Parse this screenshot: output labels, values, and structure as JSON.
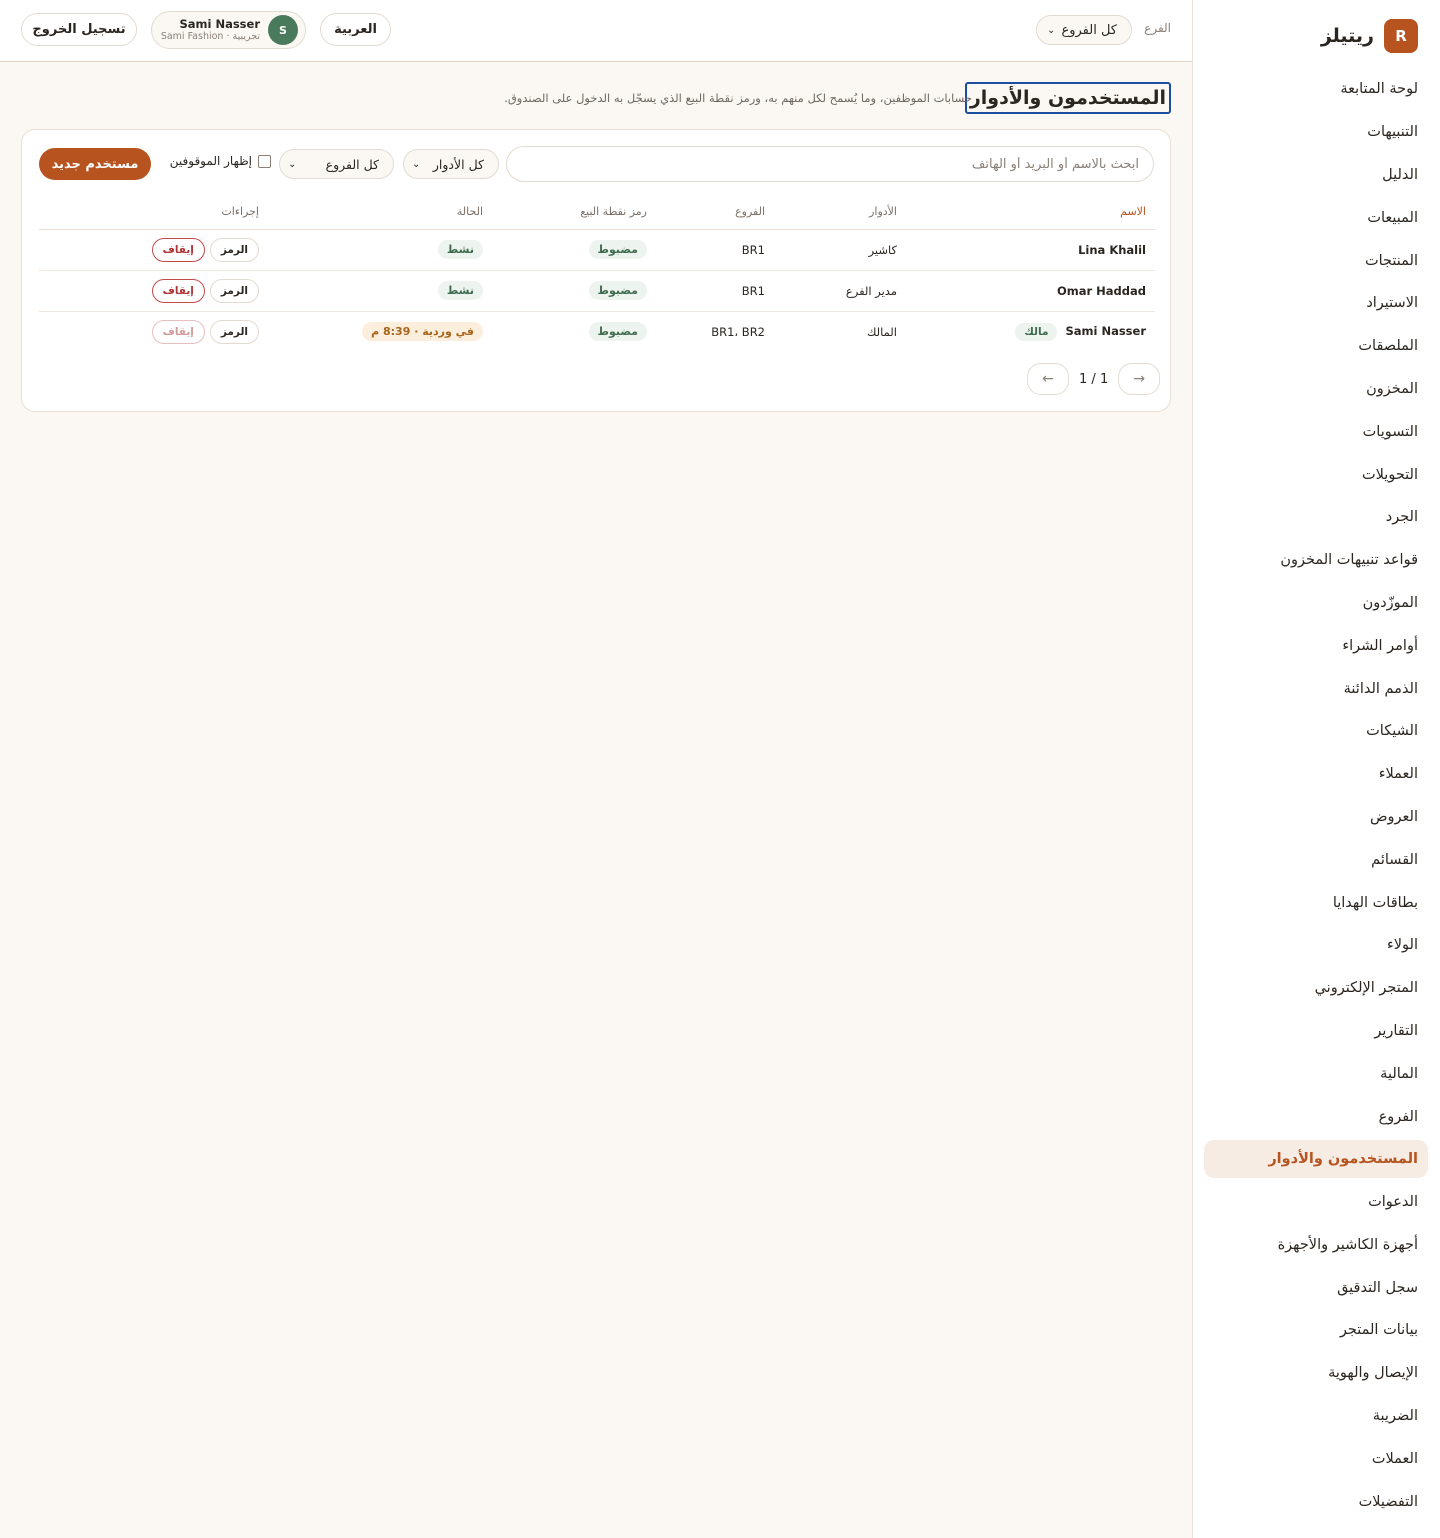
{
  "brand": {
    "logo_letter": "R",
    "name": "ريتيلز"
  },
  "sidebar": {
    "items": [
      {
        "label": "لوحة المتابعة"
      },
      {
        "label": "التنبيهات"
      },
      {
        "label": "الدليل"
      },
      {
        "label": "المبيعات"
      },
      {
        "label": "المنتجات"
      },
      {
        "label": "الاستيراد"
      },
      {
        "label": "الملصقات"
      },
      {
        "label": "المخزون"
      },
      {
        "label": "التسويات"
      },
      {
        "label": "التحويلات"
      },
      {
        "label": "الجرد"
      },
      {
        "label": "قواعد تنبيهات المخزون"
      },
      {
        "label": "الموزّدون"
      },
      {
        "label": "أوامر الشراء"
      },
      {
        "label": "الذمم الدائنة"
      },
      {
        "label": "الشيكات"
      },
      {
        "label": "العملاء"
      },
      {
        "label": "العروض"
      },
      {
        "label": "القسائم"
      },
      {
        "label": "بطاقات الهدايا"
      },
      {
        "label": "الولاء"
      },
      {
        "label": "المتجر الإلكتروني"
      },
      {
        "label": "التقارير"
      },
      {
        "label": "المالية"
      },
      {
        "label": "الفروع"
      },
      {
        "label": "المستخدمون والأدوار",
        "active": true
      },
      {
        "label": "الدعوات"
      },
      {
        "label": "أجهزة الكاشير والأجهزة"
      },
      {
        "label": "سجل التدقيق"
      },
      {
        "label": "بيانات المتجر"
      },
      {
        "label": "الإيصال والهوية"
      },
      {
        "label": "الضريبة"
      },
      {
        "label": "العملات"
      },
      {
        "label": "التفضيلات"
      }
    ]
  },
  "topbar": {
    "branch_label": "الفرع",
    "branch_value": "كل الفروع",
    "language": "العربية",
    "user": {
      "initial": "S",
      "name": "Sami Nasser",
      "subtitle": "تجريبية · Sami Fashion"
    },
    "logout": "تسجيل الخروج"
  },
  "page": {
    "title": "المستخدمون والأدوار",
    "description": "حسابات الموظفين، وما يُسمح لكل منهم به، ورمز نقطة البيع الذي يسجّل به الدخول على الصندوق."
  },
  "toolbar": {
    "search_placeholder": "ابحث بالاسم أو البريد أو الهاتف",
    "roles_filter": "كل الأدوار",
    "branches_filter": "كل الفروع",
    "show_suspended": "إظهار الموقوفين",
    "new_user": "مستخدم جديد"
  },
  "table": {
    "headers": [
      "الاسم",
      "الأدوار",
      "الفروع",
      "رمز نقطة البيع",
      "الحالة",
      "إجراءات"
    ],
    "rows": [
      {
        "name": "Lina Khalil",
        "owner_badge": "",
        "roles": "كاشير",
        "branches": "BR1",
        "pin": "مضبوط",
        "status": "نشط",
        "status_kind": "green",
        "pin_action": "الرمز",
        "suspend_action": "إيقاف",
        "suspend_disabled": false
      },
      {
        "name": "Omar Haddad",
        "owner_badge": "",
        "roles": "مدير الفرع",
        "branches": "BR1",
        "pin": "مضبوط",
        "status": "نشط",
        "status_kind": "green",
        "pin_action": "الرمز",
        "suspend_action": "إيقاف",
        "suspend_disabled": false
      },
      {
        "name": "Sami Nasser",
        "owner_badge": "مالك",
        "roles": "المالك",
        "branches": "BR1، BR2",
        "pin": "مضبوط",
        "status": "في وردية · 8:39 م",
        "status_kind": "amber",
        "pin_action": "الرمز",
        "suspend_action": "إيقاف",
        "suspend_disabled": true
      }
    ]
  },
  "pagination": {
    "text": "1 / 1",
    "prev_icon": "←",
    "next_icon": "→"
  },
  "colors": {
    "accent": "#b6531f",
    "success": "#3f6b4e",
    "warning": "#a8641b",
    "danger": "#b03636"
  }
}
